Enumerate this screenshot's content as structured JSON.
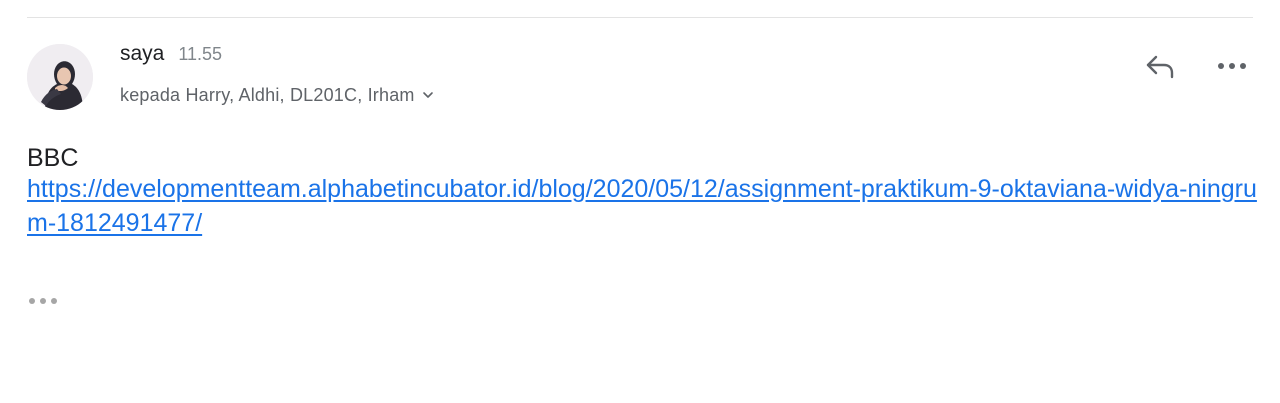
{
  "message": {
    "sender": "saya",
    "time": "11.55",
    "recipients": "kepada Harry, Aldhi, DL201C, Irham",
    "body_text": "BBC",
    "link": "https://developmentteam.alphabetincubator.id/blog/2020/05/12/assignment-praktikum-9-oktaviana-widya-ningrum-1812491477/"
  },
  "icons": {
    "avatar": "profile-photo",
    "recipients_toggle": "chevron-down-icon",
    "reply": "reply-icon",
    "more": "more-horizontal-icon",
    "trimmed": "ellipsis-icon"
  },
  "colors": {
    "link": "#1a73e8",
    "secondary_text": "#5f6368",
    "time": "#80868b",
    "icon": "#5f6368"
  }
}
